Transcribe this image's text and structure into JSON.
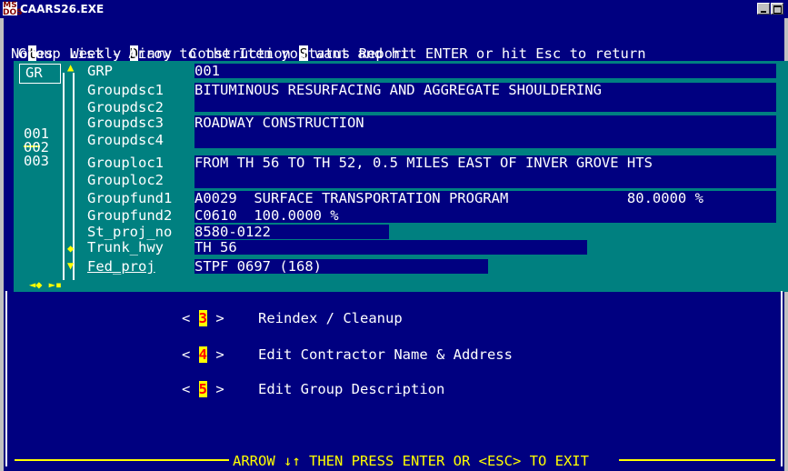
{
  "window": {
    "title": "CAARS26.EXE",
    "icon_text": "MS DOS"
  },
  "menubar": {
    "items": [
      {
        "pre": "No",
        "hot": "t",
        "post": "es"
      },
      {
        "pre": "Weekly ",
        "hot": "D",
        "post": "iary"
      },
      {
        "pre": "Construction ",
        "hot": "S",
        "post": "tatus Report"
      }
    ]
  },
  "hint": "Group List - Arrow to the Item you want and hit ENTER or hit Esc to return",
  "group_list": {
    "header": "GR",
    "items": [
      "001",
      "002",
      "003"
    ],
    "selected": "001"
  },
  "fields": [
    {
      "name": "GRP",
      "value": "001"
    },
    {
      "name": "Groupdsc1",
      "value": "BITUMINOUS RESURFACING AND AGGREGATE SHOULDERING"
    },
    {
      "name": "Groupdsc2",
      "value": ""
    },
    {
      "name": "Groupdsc3",
      "value": "ROADWAY CONSTRUCTION"
    },
    {
      "name": "Groupdsc4",
      "value": ""
    },
    {
      "name": "Grouploc1",
      "value": "FROM TH 56 TO TH 52, 0.5 MILES EAST OF INVER GROVE HTS"
    },
    {
      "name": "Grouploc2",
      "value": ""
    },
    {
      "name": "Groupfund1",
      "value": "A0029  SURFACE TRANSPORTATION PROGRAM              80.0000 %"
    },
    {
      "name": "Groupfund2",
      "value": "C0610  100.0000 %"
    },
    {
      "name": "St_proj_no",
      "value": "8580-0122"
    },
    {
      "name": "Trunk_hwy",
      "value": "TH 56"
    },
    {
      "name": "Fed_proj",
      "value": "STPF 0697 (168)"
    }
  ],
  "menu": [
    {
      "num": "3",
      "label": "Reindex / Cleanup"
    },
    {
      "num": "4",
      "label": "Edit Contractor Name & Address"
    },
    {
      "num": "5",
      "label": "Edit Group Description"
    }
  ],
  "status": "ARROW ↓↑ THEN PRESS ENTER OR <ESC> TO EXIT",
  "colors": {
    "console_bg": "#000080",
    "panel_bg": "#008080",
    "highlight": "#ffff00",
    "hotkey_num": "#ff0000"
  }
}
